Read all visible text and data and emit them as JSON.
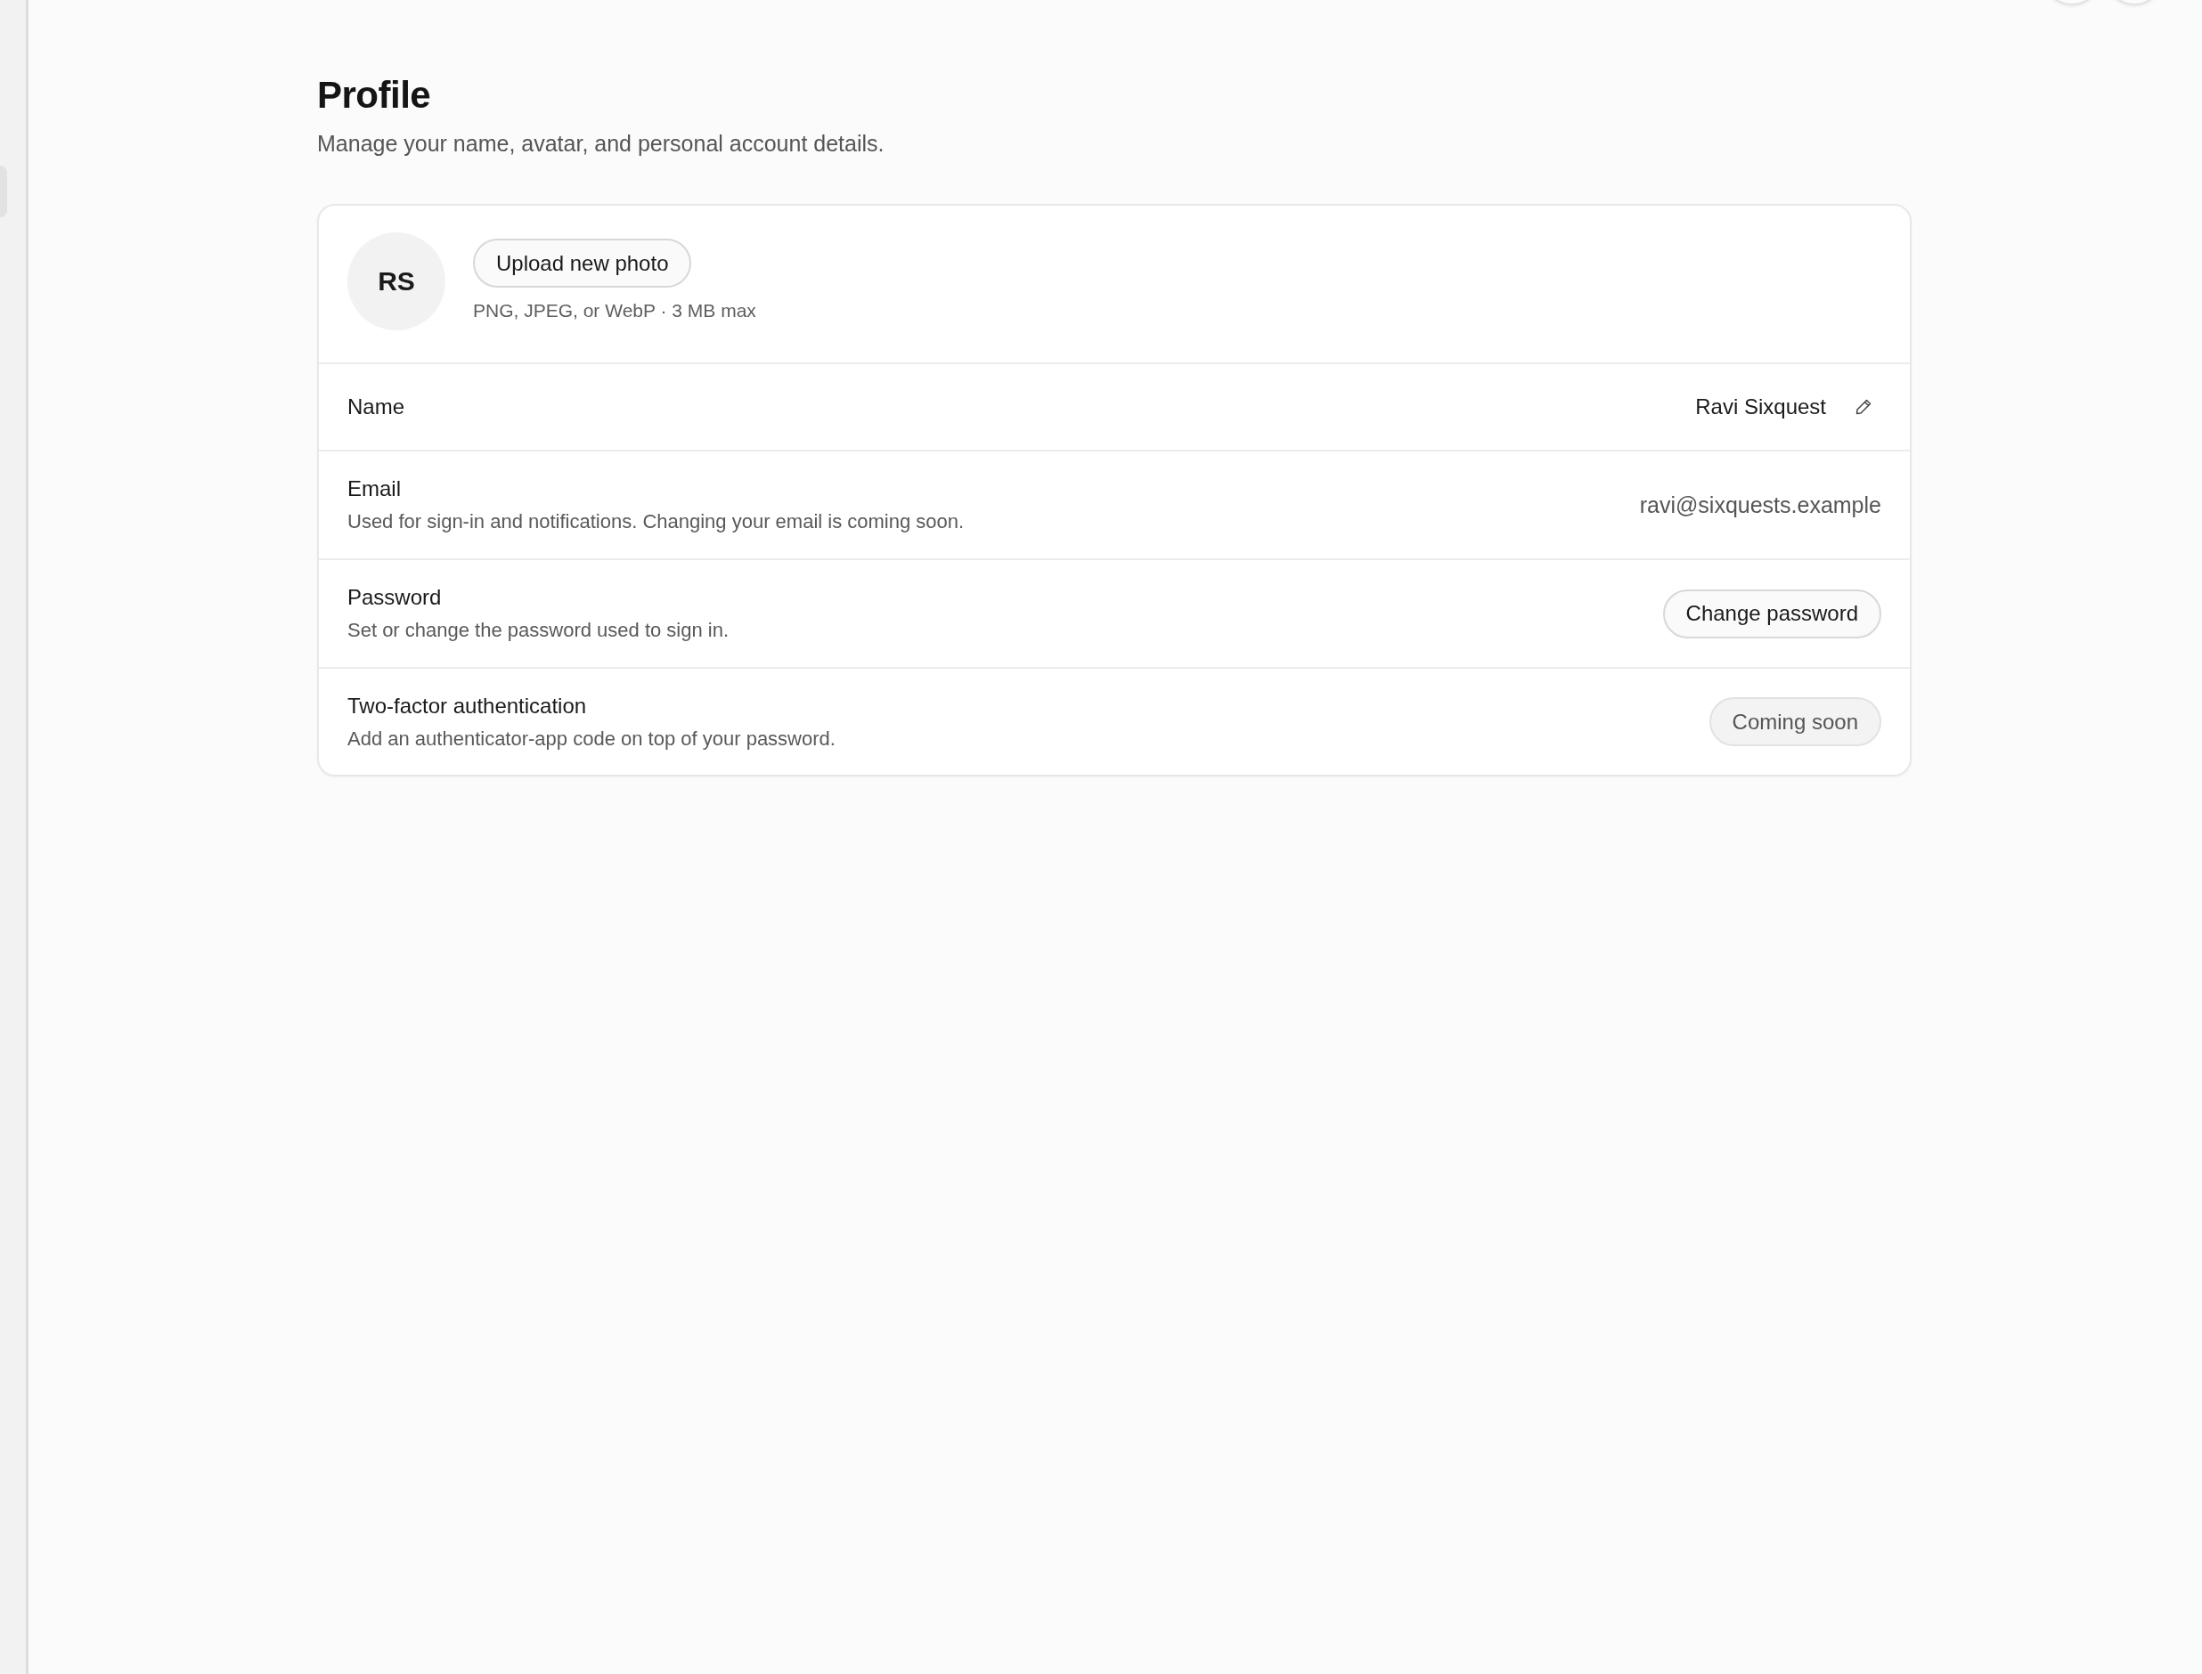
{
  "sidebar": {
    "items": [
      {
        "selected": true
      }
    ]
  },
  "page": {
    "title": "Profile",
    "subtitle": "Manage your name, avatar, and personal account details."
  },
  "avatar": {
    "initials": "RS",
    "upload_button": "Upload new photo",
    "hint": "PNG, JPEG, or WebP · 3 MB max"
  },
  "rows": [
    {
      "kind": "editable",
      "label": "Name",
      "value": "Ravi Sixquest"
    },
    {
      "kind": "value",
      "label": "Email",
      "description": "Used for sign-in and notifications. Changing your email is coming soon.",
      "value": "ravi@sixquests.example"
    },
    {
      "kind": "button",
      "label": "Password",
      "description": "Set or change the password used to sign in.",
      "button": {
        "label": "Change password",
        "disabled": false
      }
    },
    {
      "kind": "button",
      "label": "Two-factor authentication",
      "description": "Add an authenticator-app code on top of your password.",
      "button": {
        "label": "Coming soon",
        "disabled": true
      }
    }
  ]
}
